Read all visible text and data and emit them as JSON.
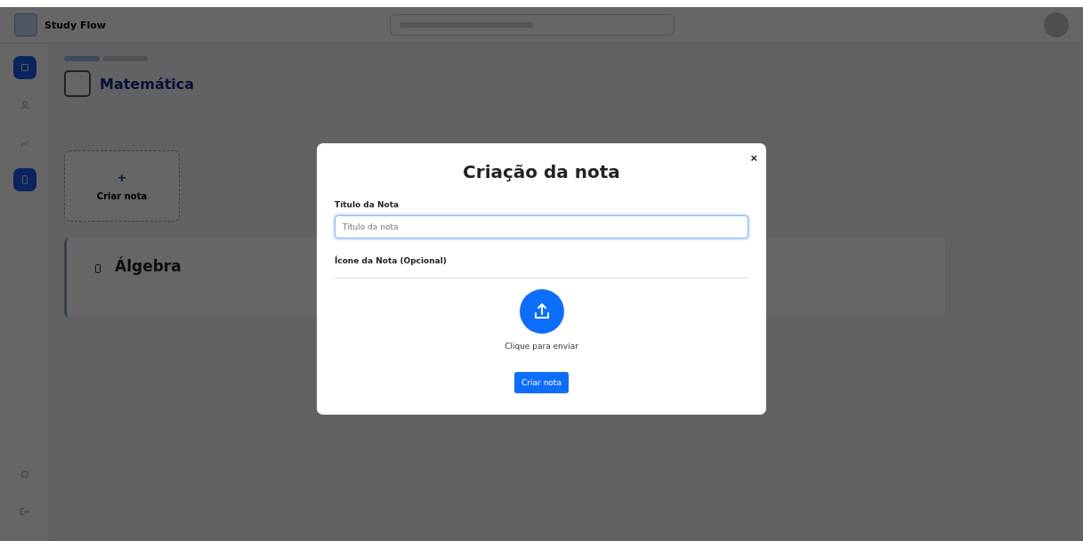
{
  "app": {
    "name": "Study Flow"
  },
  "sidebar": {
    "items": [
      {
        "kind": "home",
        "selected": true
      },
      {
        "kind": "user",
        "selected": false
      },
      {
        "kind": "chart",
        "selected": false
      },
      {
        "kind": "notes",
        "selected": true
      }
    ],
    "bottom_items": [
      {
        "kind": "settings"
      },
      {
        "kind": "logout"
      }
    ]
  },
  "subject": {
    "title": "Matemática"
  },
  "create_card": {
    "icon": "+",
    "label": "Criar nota"
  },
  "notes": [
    {
      "title": "Álgebra"
    }
  ],
  "modal": {
    "title": "Criação da nota",
    "close": "×",
    "title_label": "Título da Nota",
    "title_placeholder": "Título da nota",
    "icon_label": "Ícone da Nota (Opcional)",
    "upload_hint": "Clique para enviar",
    "submit": "Criar nota"
  }
}
